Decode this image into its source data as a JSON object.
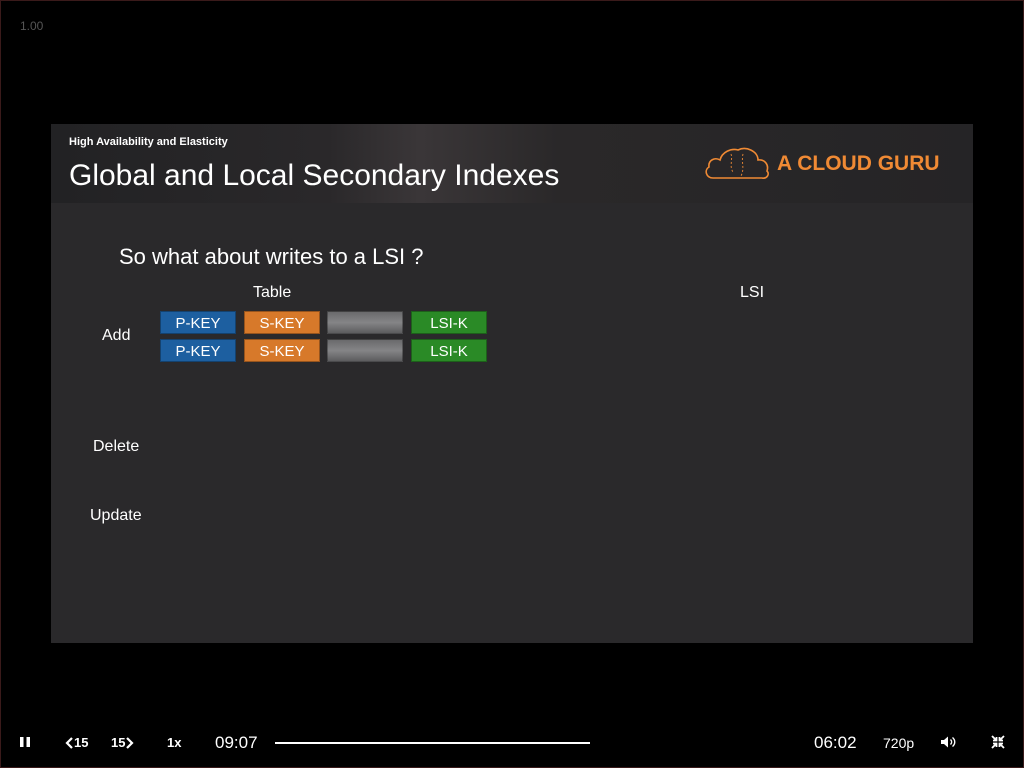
{
  "player": {
    "rate_display": "1.00",
    "speed_label": "1x",
    "rewind_label": "15",
    "forward_label": "15",
    "elapsed": "09:07",
    "remaining": "06:02",
    "quality": "720p",
    "progress_fraction": 1.0,
    "icons": {
      "pause": "pause-icon",
      "rewind": "rewind-15-icon",
      "forward": "forward-15-icon",
      "volume": "volume-icon",
      "exit_fullscreen": "exit-fullscreen-icon"
    }
  },
  "slide": {
    "course": "High Availability and Elasticity",
    "title": "Global and Local Secondary Indexes",
    "brand": "A CLOUD GURU",
    "brand_color": "#f08a34",
    "question": "So what about writes to a LSI ?",
    "table_header": "Table",
    "lsi_header": "LSI",
    "rows": {
      "add": "Add",
      "delete": "Delete",
      "update": "Update"
    },
    "cells": {
      "pkey": "P-KEY",
      "skey": "S-KEY",
      "attr": "",
      "lsik": "LSI-K"
    },
    "colors": {
      "pkey": "#1d5fa0",
      "skey": "#d7792a",
      "lsik": "#2a8a26"
    }
  }
}
